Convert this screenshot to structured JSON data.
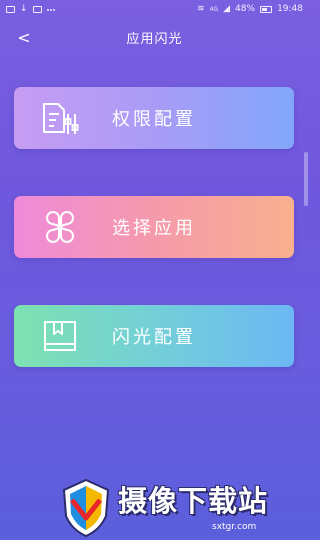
{
  "status_bar": {
    "battery": "48%",
    "time": "19:48",
    "network": "4G"
  },
  "header": {
    "back_glyph": "<",
    "title": "应用闪光"
  },
  "menu": [
    {
      "label": "权限配置",
      "icon": "document-settings-icon"
    },
    {
      "label": "选择应用",
      "icon": "app-grid-icon"
    },
    {
      "label": "闪光配置",
      "icon": "book-icon"
    }
  ],
  "watermark": {
    "text": "摄像下载站",
    "url": "sxtgr.com"
  },
  "colors": {
    "background_top": "#7a5fe0",
    "background_bottom": "#5b5fdc",
    "button1_gradient": [
      "#c79cf3",
      "#82a6fb"
    ],
    "button2_gradient": [
      "#ef8ad9",
      "#f8b08e"
    ],
    "button3_gradient": [
      "#7de2b0",
      "#6cb8f5"
    ]
  }
}
